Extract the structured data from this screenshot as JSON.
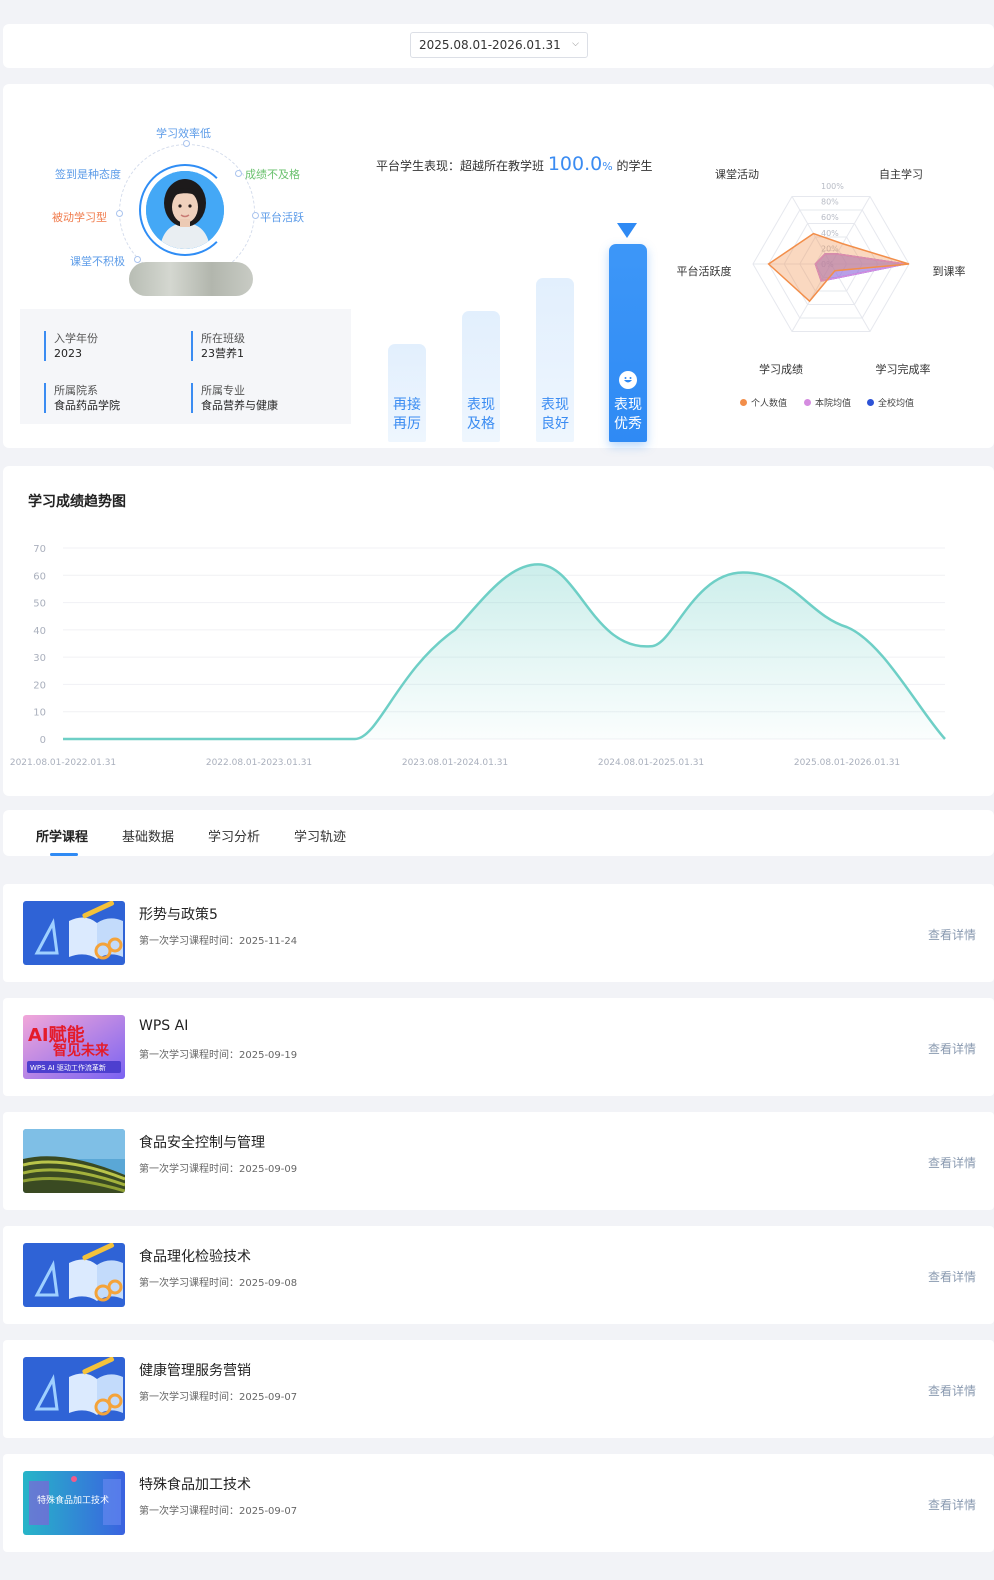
{
  "date_range": {
    "value": "2025.08.01-2026.01.31"
  },
  "profile": {
    "tags": [
      {
        "label": "学习效率低",
        "color": "#5b9be8"
      },
      {
        "label": "签到是种态度",
        "color": "#5b9be8"
      },
      {
        "label": "成绩不及格",
        "color": "#6ac16e"
      },
      {
        "label": "被动学习型",
        "color": "#f07a4a"
      },
      {
        "label": "平台活跃",
        "color": "#5b9be8"
      },
      {
        "label": "课堂不积极",
        "color": "#5b9be8"
      }
    ],
    "info": [
      {
        "label": "入学年份",
        "value": "2023"
      },
      {
        "label": "所在班级",
        "value": "23营养1"
      },
      {
        "label": "所属院系",
        "value": "食品药品学院"
      },
      {
        "label": "所属专业",
        "value": "食品营养与健康"
      }
    ]
  },
  "performance": {
    "text_prefix": "平台学生表现：超越所在教学班",
    "percent": "100.0",
    "percent_sign": "%",
    "text_suffix": "的学生",
    "levels": [
      {
        "line1": "再接",
        "line2": "再厉"
      },
      {
        "line1": "表现",
        "line2": "及格"
      },
      {
        "line1": "表现",
        "line2": "良好"
      },
      {
        "line1": "表现",
        "line2": "优秀"
      }
    ],
    "active_level": 3
  },
  "radar": {
    "type": "radar",
    "axes": [
      "课堂活动",
      "自主学习",
      "到课率",
      "学习完成率",
      "学习成绩",
      "平台活跃度"
    ],
    "ticks": [
      "100%",
      "80%",
      "60%",
      "40%",
      "20%",
      "0%"
    ],
    "series": [
      {
        "name": "个人数值",
        "color": "#f28e4a",
        "values": [
          45,
          30,
          100,
          10,
          55,
          80
        ]
      },
      {
        "name": "本院均值",
        "color": "#d58ce0",
        "values": [
          15,
          15,
          95,
          20,
          25,
          20
        ]
      },
      {
        "name": "全校均值",
        "color": "#2d52d6",
        "values": [
          15,
          15,
          95,
          20,
          25,
          20
        ]
      }
    ]
  },
  "trend": {
    "title": "学习成绩趋势图",
    "chart_data": {
      "type": "area",
      "x": [
        "2021.08.01-2022.01.31",
        "2022.08.01-2023.01.31",
        "2023.08.01-2024.01.31",
        "2024.08.01-2025.01.31",
        "2025.08.01-2026.01.31"
      ],
      "yticks": [
        "70",
        "60",
        "50",
        "40",
        "30",
        "20",
        "10",
        "0"
      ],
      "ylim": [
        0,
        70
      ],
      "series": [
        {
          "values": [
            0,
            0,
            40,
            34,
            41
          ]
        }
      ],
      "color": "#6ecfc6"
    }
  },
  "tabs": [
    {
      "label": "所学课程"
    },
    {
      "label": "基础数据"
    },
    {
      "label": "学习分析"
    },
    {
      "label": "学习轨迹"
    }
  ],
  "course_time_prefix": "第一次学习课程时间：",
  "detail_label": "查看详情",
  "courses": [
    {
      "name": "形势与政策5",
      "time": "2025-11-24",
      "thumb": "book"
    },
    {
      "name": "WPS AI",
      "time": "2025-09-19",
      "thumb": "wps",
      "thumb_title_1": "AI赋能",
      "thumb_title_2": "智见未来",
      "thumb_caption": "WPS AI 驱动工作流革新"
    },
    {
      "name": "食品安全控制与管理",
      "time": "2025-09-09",
      "thumb": "terrace"
    },
    {
      "name": "食品理化检验技术",
      "time": "2025-09-08",
      "thumb": "book"
    },
    {
      "name": "健康管理服务营销",
      "time": "2025-09-07",
      "thumb": "book"
    },
    {
      "name": "特殊食品加工技术",
      "time": "2025-09-07",
      "thumb": "special",
      "thumb_title": "特殊食品加工技术"
    }
  ]
}
